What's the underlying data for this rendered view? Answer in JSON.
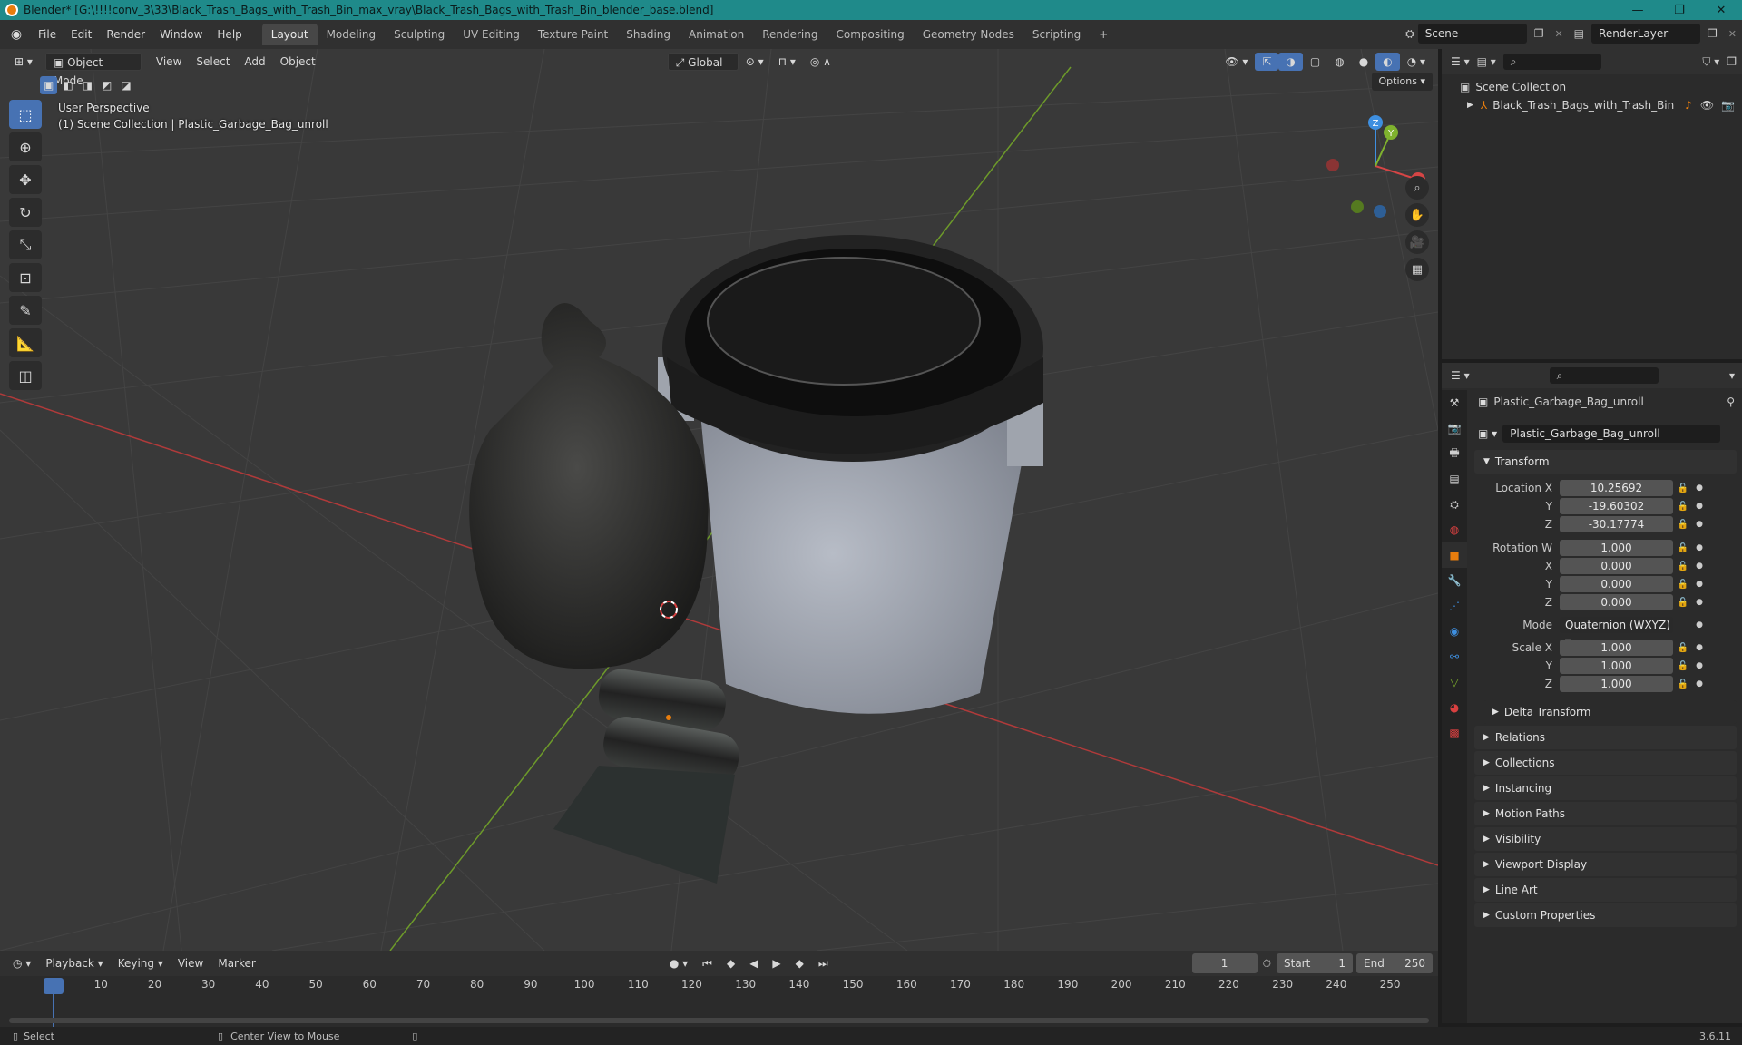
{
  "window": {
    "title": "Blender* [G:\\!!!!conv_3\\33\\Black_Trash_Bags_with_Trash_Bin_max_vray\\Black_Trash_Bags_with_Trash_Bin_blender_base.blend]",
    "minimize": "—",
    "maximize": "❐",
    "close": "✕"
  },
  "menu": [
    "File",
    "Edit",
    "Render",
    "Window",
    "Help"
  ],
  "workspaces": [
    {
      "label": "Layout",
      "active": true
    },
    {
      "label": "Modeling"
    },
    {
      "label": "Sculpting"
    },
    {
      "label": "UV Editing"
    },
    {
      "label": "Texture Paint"
    },
    {
      "label": "Shading"
    },
    {
      "label": "Animation"
    },
    {
      "label": "Rendering"
    },
    {
      "label": "Compositing"
    },
    {
      "label": "Geometry Nodes"
    },
    {
      "label": "Scripting"
    }
  ],
  "add_workspace": "+",
  "scene": {
    "name": "Scene",
    "render_layer": "RenderLayer"
  },
  "viewport": {
    "mode": "Object Mode",
    "menus": [
      "View",
      "Select",
      "Add",
      "Object"
    ],
    "orientation": "Global",
    "options": "Options",
    "info_line1": "User Perspective",
    "info_line2": "(1) Scene Collection | Plastic_Garbage_Bag_unroll",
    "gizmo": {
      "x": "X",
      "y": "Y",
      "z": "Z"
    }
  },
  "outliner": {
    "root": "Scene Collection",
    "items": [
      {
        "label": "Black_Trash_Bags_with_Trash_Bin"
      }
    ]
  },
  "properties": {
    "object_name": "Plastic_Garbage_Bag_unroll",
    "data_name": "Plastic_Garbage_Bag_unroll",
    "transform_title": "Transform",
    "location": {
      "label": "Location X",
      "x": "10.25692",
      "y": "-19.60302",
      "z": "-30.17774"
    },
    "rotation": {
      "label": "Rotation W",
      "w": "1.000",
      "x": "0.000",
      "y": "0.000",
      "z": "0.000"
    },
    "mode_label": "Mode",
    "mode_value": "Quaternion (WXYZ)",
    "scale": {
      "label": "Scale X",
      "x": "1.000",
      "y": "1.000",
      "z": "1.000"
    },
    "axis_labels": {
      "x": "X",
      "y": "Y",
      "z": "Z"
    },
    "delta": "Delta Transform",
    "panels": [
      "Relations",
      "Collections",
      "Instancing",
      "Motion Paths",
      "Visibility",
      "Viewport Display",
      "Line Art",
      "Custom Properties"
    ]
  },
  "timeline": {
    "menus": [
      "Playback",
      "Keying",
      "View",
      "Marker"
    ],
    "current_frame": "1",
    "start_label": "Start",
    "start": "1",
    "end_label": "End",
    "end": "250",
    "ticks": [
      "1",
      "10",
      "20",
      "30",
      "40",
      "50",
      "60",
      "70",
      "80",
      "90",
      "100",
      "110",
      "120",
      "130",
      "140",
      "150",
      "160",
      "170",
      "180",
      "190",
      "200",
      "210",
      "220",
      "230",
      "240",
      "250"
    ]
  },
  "status": {
    "select": "Select",
    "center": "Center View to Mouse",
    "version": "3.6.11"
  },
  "colors": {
    "titlebar": "#1f8a8a",
    "accent": "#4772b3",
    "orange": "#e87d0d",
    "x_axis": "#d64545",
    "y_axis": "#7fb22e",
    "z_axis": "#3e8fe0"
  }
}
